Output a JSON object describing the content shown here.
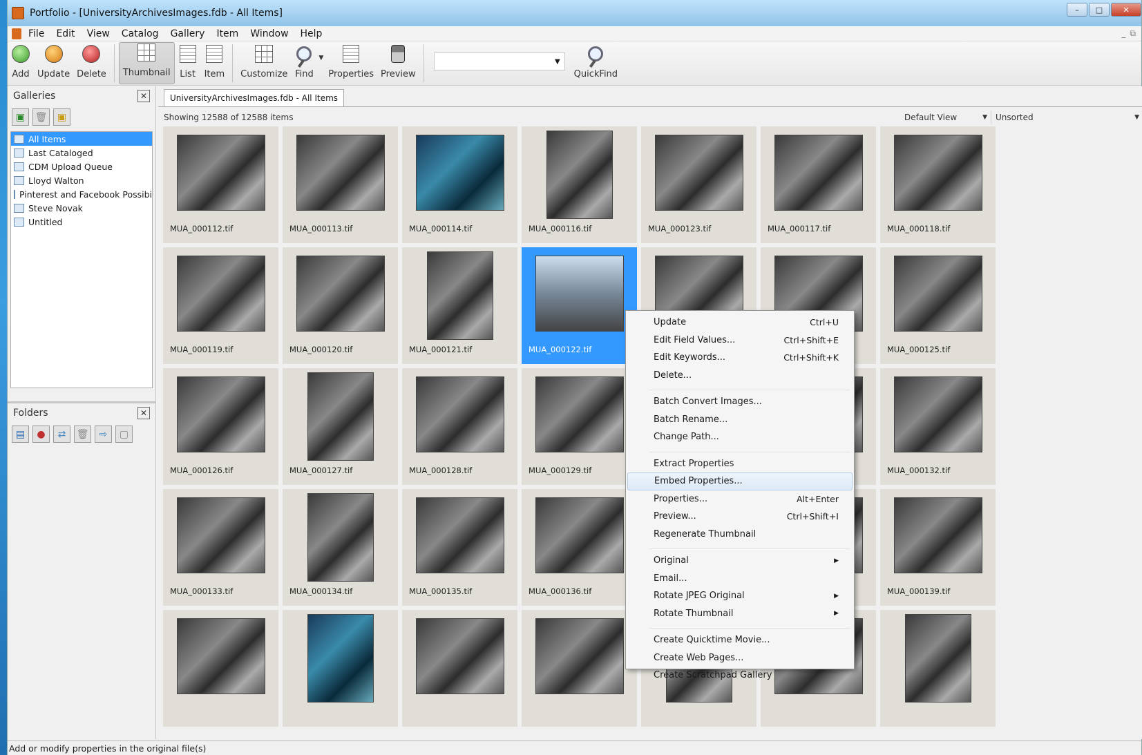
{
  "window": {
    "title": "Portfolio - [UniversityArchivesImages.fdb - All Items]",
    "controls": {
      "minimize": "–",
      "maximize": "□",
      "close": "✕"
    }
  },
  "menubar": [
    "File",
    "Edit",
    "View",
    "Catalog",
    "Gallery",
    "Item",
    "Window",
    "Help"
  ],
  "toolbar": {
    "add": "Add",
    "update": "Update",
    "delete": "Delete",
    "thumbnail": "Thumbnail",
    "list": "List",
    "item": "Item",
    "customize": "Customize",
    "find": "Find",
    "properties": "Properties",
    "preview": "Preview",
    "quickfind": "QuickFind",
    "quickfind_value": ""
  },
  "galleries": {
    "title": "Galleries",
    "items": [
      "All Items",
      "Last Cataloged",
      "CDM Upload Queue",
      "Lloyd Walton",
      "Pinterest and Facebook Possibi",
      "Steve Novak",
      "Untitled"
    ],
    "selected": "All Items"
  },
  "folders": {
    "title": "Folders"
  },
  "main": {
    "tab": "UniversityArchivesImages.fdb - All Items",
    "showing": "Showing 12588 of 12588 items",
    "view": "Default View",
    "sort": "Unsorted"
  },
  "thumbnails": [
    "MUA_000112.tif",
    "MUA_000113.tif",
    "MUA_000114.tif",
    "MUA_000116.tif",
    "MUA_000123.tif",
    "MUA_000117.tif",
    "MUA_000118.tif",
    "MUA_000119.tif",
    "MUA_000120.tif",
    "MUA_000121.tif",
    "MUA_000122.tif",
    "",
    "",
    "MUA_000125.tif",
    "MUA_000126.tif",
    "MUA_000127.tif",
    "MUA_000128.tif",
    "MUA_000129.tif",
    "",
    "",
    "MUA_000132.tif",
    "MUA_000133.tif",
    "MUA_000134.tif",
    "MUA_000135.tif",
    "MUA_000136.tif",
    "",
    "",
    "MUA_000139.tif",
    "",
    "",
    "",
    "",
    "",
    "",
    ""
  ],
  "context_menu": {
    "update": "Update",
    "update_sc": "Ctrl+U",
    "edit_fields": "Edit Field Values...",
    "edit_fields_sc": "Ctrl+Shift+E",
    "edit_keywords": "Edit Keywords...",
    "edit_keywords_sc": "Ctrl+Shift+K",
    "delete": "Delete...",
    "batch_convert": "Batch Convert Images...",
    "batch_rename": "Batch Rename...",
    "change_path": "Change Path...",
    "extract": "Extract Properties",
    "embed": "Embed Properties...",
    "properties": "Properties...",
    "properties_sc": "Alt+Enter",
    "preview": "Preview...",
    "preview_sc": "Ctrl+Shift+I",
    "regen": "Regenerate Thumbnail",
    "original": "Original",
    "email": "Email...",
    "rotate_jpeg": "Rotate JPEG Original",
    "rotate_thumb": "Rotate Thumbnail",
    "quicktime": "Create Quicktime Movie...",
    "web_pages": "Create Web Pages...",
    "scratchpad": "Create Scratchpad Gallery"
  },
  "status": "Add or modify properties in the original file(s)"
}
